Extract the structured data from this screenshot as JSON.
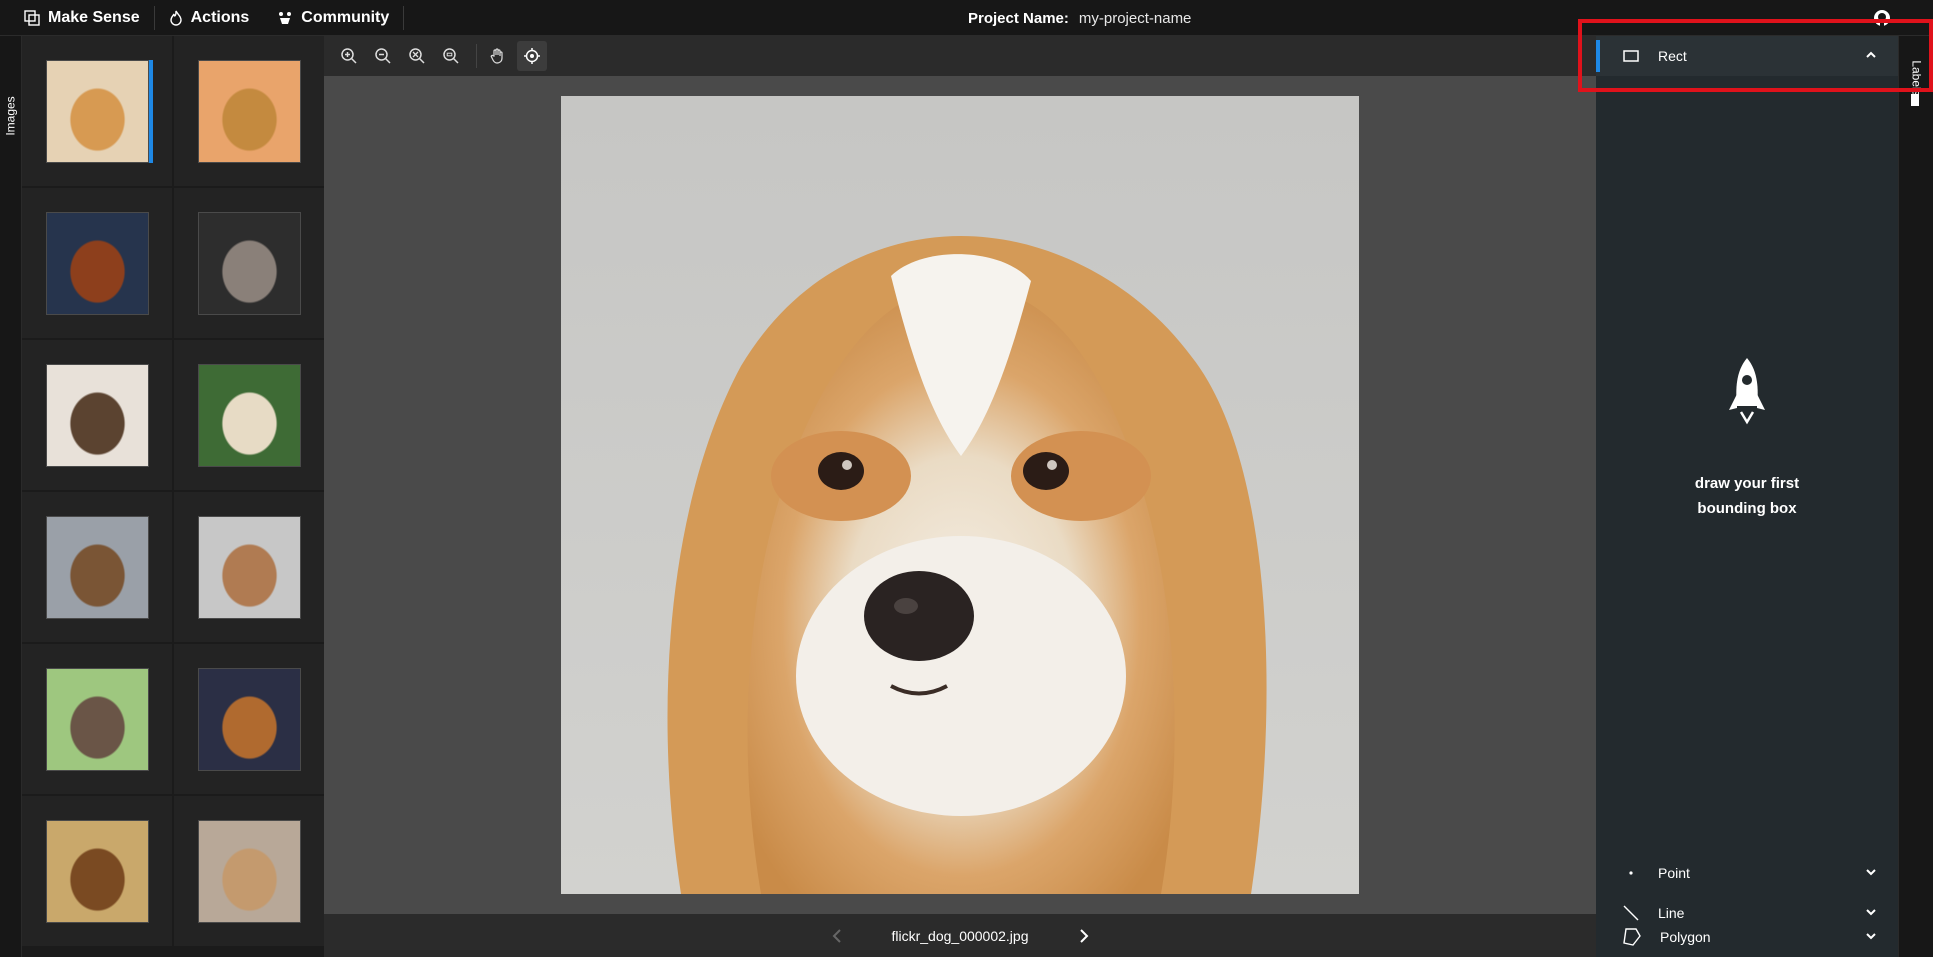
{
  "nav": {
    "brand": "Make Sense",
    "actions": "Actions",
    "community": "Community"
  },
  "project": {
    "label": "Project Name:",
    "value": "my-project-name"
  },
  "left_tab": {
    "label": "Images"
  },
  "right_tab": {
    "label": "Labels"
  },
  "thumbnails": [
    {
      "bg": "#e6d2b4",
      "fur": "#d79a52",
      "active": true
    },
    {
      "bg": "#e9a46b",
      "fur": "#c48a3f",
      "active": false
    },
    {
      "bg": "#26344d",
      "fur": "#8d3f1c",
      "active": false
    },
    {
      "bg": "#2d2d2d",
      "fur": "#8a8079",
      "active": false
    },
    {
      "bg": "#e8e1d9",
      "fur": "#5b4330",
      "active": false
    },
    {
      "bg": "#3e6b35",
      "fur": "#e7dbc5",
      "active": false
    },
    {
      "bg": "#9aa0a8",
      "fur": "#7a5535",
      "active": false
    },
    {
      "bg": "#c7c7c7",
      "fur": "#b07b52",
      "active": false
    },
    {
      "bg": "#9ec77f",
      "fur": "#6a5547",
      "active": false
    },
    {
      "bg": "#2b2f45",
      "fur": "#b06a2f",
      "active": false
    },
    {
      "bg": "#c9a86b",
      "fur": "#7a4a22",
      "active": false
    },
    {
      "bg": "#b8a898",
      "fur": "#c49a6e",
      "active": false
    }
  ],
  "editor": {
    "filename": "flickr_dog_000002.jpg"
  },
  "labels": {
    "rect": "Rect",
    "point": "Point",
    "line": "Line",
    "polygon": "Polygon",
    "empty_message": "draw your first bounding box"
  },
  "colors": {
    "accent": "#1e88e5",
    "highlight": "#e0121b"
  }
}
